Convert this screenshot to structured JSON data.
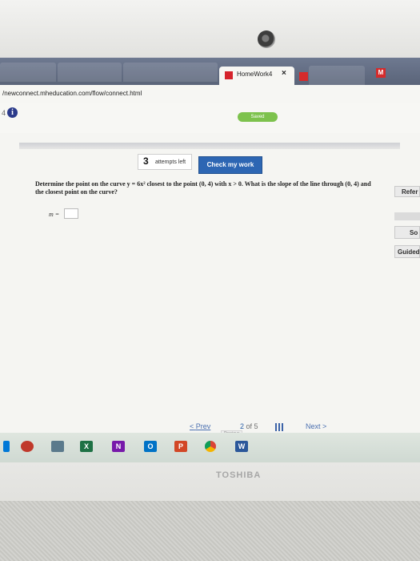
{
  "browser": {
    "active_tab_title": "HomeWork4",
    "active_tab_close": "×",
    "url": "/newconnect.mheducation.com/flow/connect.html",
    "m_favicon_letter": "M"
  },
  "appbar": {
    "question_number": "4",
    "info_glyph": "i",
    "saved_label": "Saved"
  },
  "question": {
    "attempts_count": "3",
    "attempts_text": "attempts left",
    "check_button": "Check my work",
    "text": "Determine the point on the curve y = 6x² closest to the point (0, 4) with x > 0. What is the slope of the line through (0, 4) and the closest point on the curve?",
    "answer_label": "m =",
    "answer_value": ""
  },
  "side": {
    "references": "Refer",
    "solution": "So",
    "guided": "Guided"
  },
  "pagination": {
    "prev_label": "Prev",
    "prev_chevron": "<",
    "current": "2",
    "of_text": "of 5",
    "next_label": "Next",
    "next_chevron": ">",
    "tooltip": "Previous"
  },
  "taskbar": {
    "icons": [
      "chrome-icon",
      "excel-icon",
      "onenote-icon",
      "outlook-icon",
      "powerpoint-icon",
      "word-icon"
    ],
    "excel_letter": "X",
    "onenote_letter": "N",
    "outlook_letter": "O",
    "ppt_letter": "P",
    "word_letter": "W"
  },
  "laptop": {
    "brand": "TOSHIBA"
  }
}
